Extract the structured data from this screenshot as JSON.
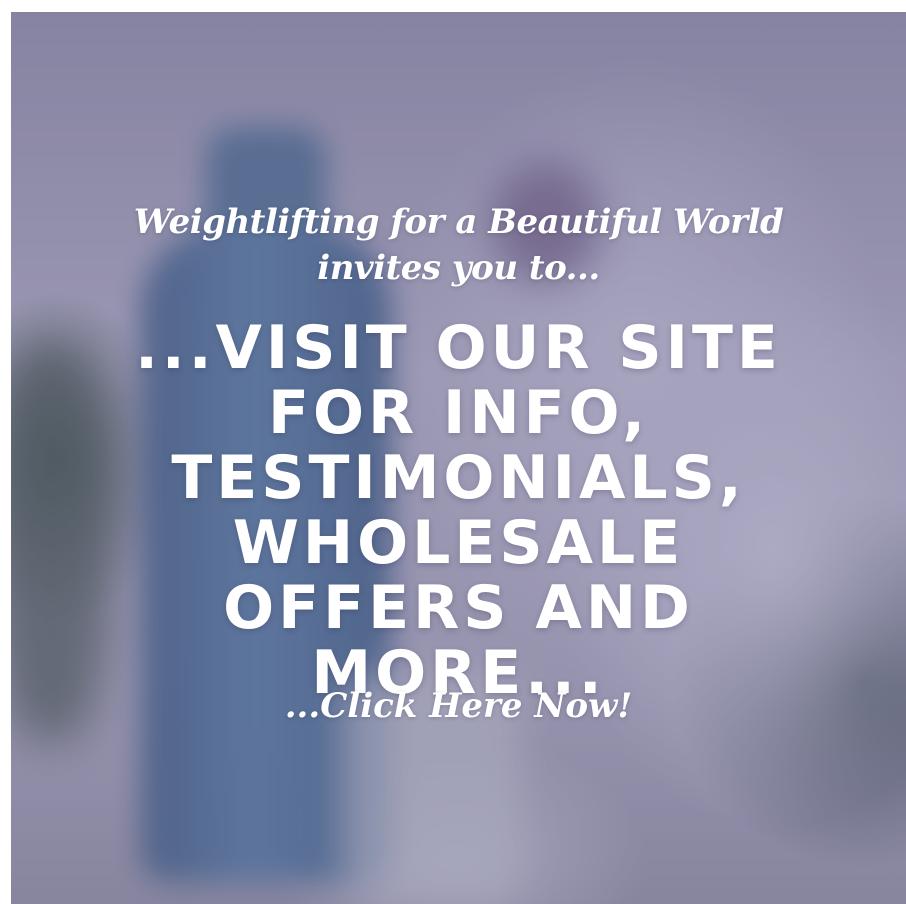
{
  "intro": {
    "line1": "Weightlifting for a Beautiful World",
    "line2": "invites you to..."
  },
  "headline": {
    "lines": [
      "...VISIT OUR SITE",
      "FOR INFO,",
      "TESTIMONIALS,",
      "WHOLESALE",
      "OFFERS AND",
      "MORE..."
    ]
  },
  "cta": {
    "label": "...Click Here Now!"
  },
  "colors": {
    "text": "#ffffff",
    "background_tint": "#9a97b3",
    "bottle": "#4a6a90"
  }
}
